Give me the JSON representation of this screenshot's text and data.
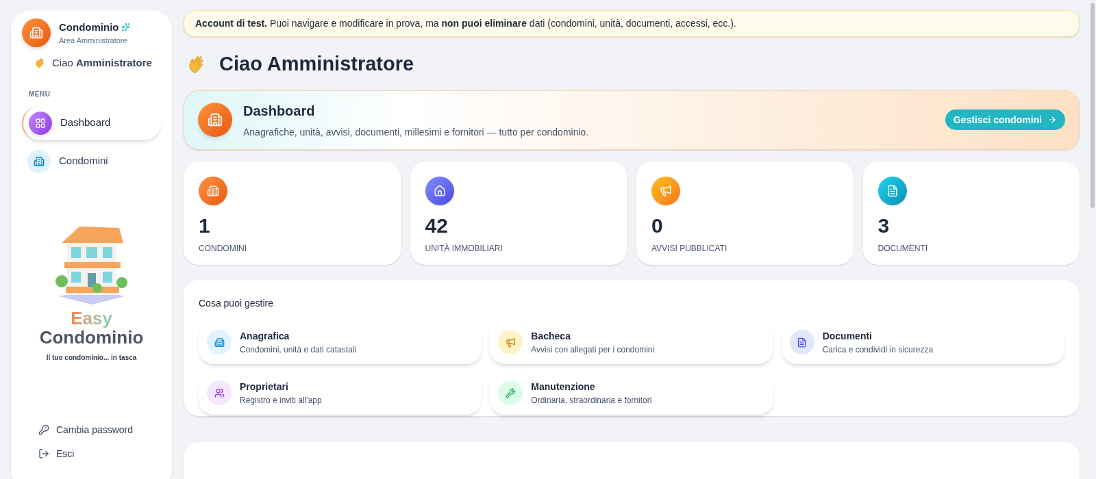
{
  "sidebar": {
    "brand": {
      "title": "Condominio",
      "subtitle": "Area Amministratore"
    },
    "greeting": {
      "prefix": "Ciao",
      "name": "Amministratore"
    },
    "menu_heading": "MENU",
    "menu": [
      {
        "kind": "grid",
        "label": "Dashboard",
        "selected": true
      },
      {
        "kind": "building",
        "label": "Condomini",
        "selected": false
      }
    ],
    "logo": {
      "easy": "Easy",
      "name": "Condominio",
      "tagline": "Il tuo condominio... in tasca"
    },
    "footer": [
      {
        "kind": "key",
        "label": "Cambia password"
      },
      {
        "kind": "logout",
        "label": "Esci"
      }
    ]
  },
  "notice": "**Account di test.** Puoi navigare e modificare in prova, ma **non puoi eliminare** dati (condomini, unità, documenti, accessi, ecc.).",
  "heading": "Ciao Amministratore",
  "hero": {
    "title": "Dashboard",
    "subtitle": "Anagrafiche, unità, avvisi, documenti, millesimi e fornitori — tutto per condominio.",
    "button": "Gestisci condomini"
  },
  "stats": [
    {
      "kind": "building",
      "value": "1",
      "label": "CONDOMINI"
    },
    {
      "kind": "home",
      "value": "42",
      "label": "UNITÀ IMMOBILIARI"
    },
    {
      "kind": "megaphone",
      "value": "0",
      "label": "AVVISI PUBBLICATI"
    },
    {
      "kind": "document",
      "value": "3",
      "label": "DOCUMENTI"
    }
  ],
  "manage": {
    "title": "Cosa puoi gestire",
    "items": [
      {
        "kind": "building",
        "title": "Anagrafica",
        "subtitle": "Condomini, unità e dati catastali"
      },
      {
        "kind": "megaphone",
        "title": "Bacheca",
        "subtitle": "Avvisi con allegati per i condomini"
      },
      {
        "kind": "document",
        "title": "Documenti",
        "subtitle": "Carica e condividi in sicurezza"
      },
      {
        "kind": "users",
        "title": "Proprietari",
        "subtitle": "Registro e inviti all'app"
      },
      {
        "kind": "wrench",
        "title": "Manutenzione",
        "subtitle": "Ordinaria, straordinaria e fornitori"
      }
    ]
  }
}
